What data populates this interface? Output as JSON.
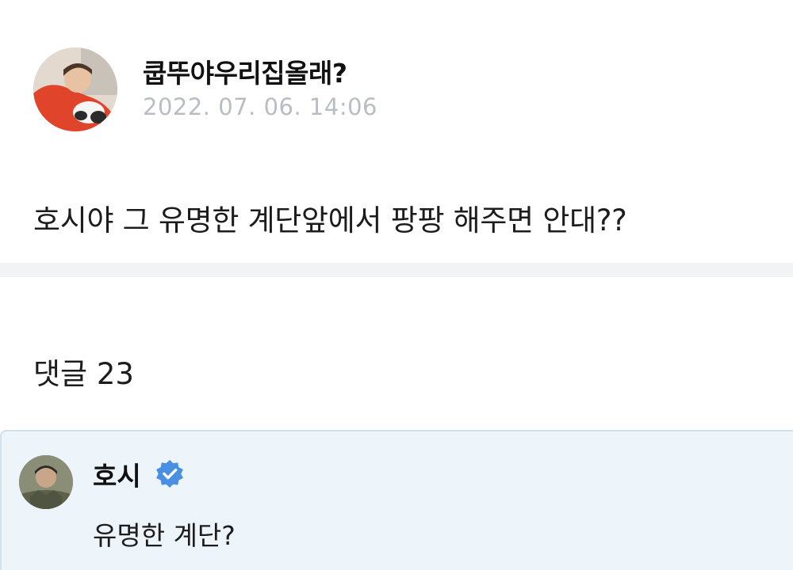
{
  "post": {
    "author": "쿱뚜야우리집올래?",
    "timestamp": "2022. 07. 06. 14:06",
    "body": "호시야 그 유명한 계단앞에서 팡팡 해주면 안대??",
    "avatar_icon": "user-photo-avatar"
  },
  "comments": {
    "header": "댓글 23",
    "items": [
      {
        "author": "호시",
        "verified": true,
        "verified_icon": "verified-badge-icon",
        "text": "유명한 계단?"
      }
    ]
  },
  "colors": {
    "timestamp": "#b9bdc3",
    "divider": "#f2f3f5",
    "comment_highlight_bg": "#edf5fb",
    "comment_highlight_border": "#cfe2ee",
    "verified_badge": "#4a90e2"
  }
}
